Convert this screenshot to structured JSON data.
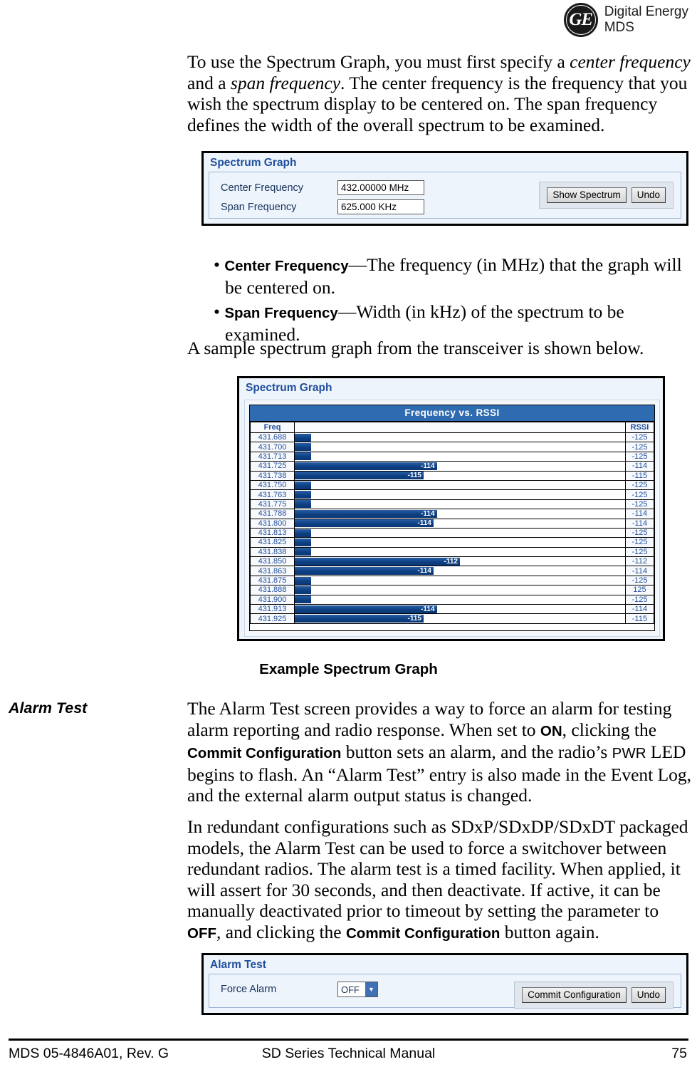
{
  "header": {
    "logo_mark": "GE",
    "logo_line1": "Digital Energy",
    "logo_line2": "MDS"
  },
  "intro_paragraph": {
    "part1": "To use the Spectrum Graph, you must first specify a ",
    "em1": "center frequency",
    "part2": " and a ",
    "em2": "span frequency",
    "part3": ". The center frequency is the frequency that you wish the spectrum display to be centered on. The span frequency defines the width of the overall spectrum to be examined."
  },
  "spectrum_panel": {
    "title": "Spectrum Graph",
    "fields": [
      {
        "label": "Center Frequency",
        "value": "432.00000 MHz"
      },
      {
        "label": "Span Frequency",
        "value": "625.000 KHz"
      }
    ],
    "buttons": [
      {
        "label": "Show Spectrum"
      },
      {
        "label": "Undo"
      }
    ]
  },
  "bullets": [
    {
      "term": "Center Frequency",
      "text": "—The frequency (in MHz) that the graph will be centered on."
    },
    {
      "term": "Span Frequency",
      "text": "—Width (in kHz) of the spectrum to be examined."
    }
  ],
  "sample_line": "A sample spectrum graph from the transceiver is shown below.",
  "graph_widget": {
    "panel_title": "Spectrum Graph",
    "chart_title": "Frequency vs. RSSI",
    "col_freq": "Freq",
    "col_rssi": "RSSI"
  },
  "chart_data": {
    "type": "bar",
    "title": "Frequency vs. RSSI",
    "xlabel": "RSSI",
    "ylabel": "Freq",
    "orientation": "horizontal",
    "grid": false,
    "legend": "none",
    "categories": [
      "431.688",
      "431.700",
      "431.713",
      "431.725",
      "431.738",
      "431.750",
      "431.763",
      "431.775",
      "431.788",
      "431.800",
      "431.813",
      "431.825",
      "431.838",
      "431.850",
      "431.863",
      "431.875",
      "431.888",
      "431.900",
      "431.913",
      "431.925"
    ],
    "values": [
      -125,
      -125,
      -125,
      -114,
      -115,
      -125,
      -125,
      -125,
      -114,
      -114,
      -125,
      -125,
      -125,
      -112,
      -114,
      -125,
      125,
      -125,
      -114,
      -115
    ],
    "bar_labels": [
      "",
      "",
      "",
      "-114",
      "-115",
      "",
      "",
      "",
      "-114",
      "-114",
      "",
      "",
      "",
      "-112",
      "-114",
      "",
      "",
      "",
      "-114",
      "-115"
    ],
    "bar_widths_pct": [
      5,
      5,
      5,
      43,
      39,
      5,
      5,
      5,
      43,
      42,
      5,
      5,
      5,
      50,
      42,
      5,
      5,
      5,
      43,
      39
    ],
    "rssi_labels": [
      "-125",
      "-125",
      "-125",
      "-114",
      "-115",
      "-125",
      "-125",
      "-125",
      "-114",
      "-114",
      "-125",
      "-125",
      "-125",
      "-112",
      "-114",
      "-125",
      "125",
      "-125",
      "-114",
      "-115"
    ]
  },
  "figure_caption": "Example Spectrum Graph",
  "alarm_section": {
    "heading": "Alarm Test",
    "para1_a": "The Alarm Test screen provides a way to force an alarm for testing alarm reporting and radio response. When set to ",
    "para1_on": "ON",
    "para1_b": ", clicking the ",
    "para1_commit": "Commit Configuration",
    "para1_c": " button sets an alarm, and the radio’s ",
    "para1_pwr": "PWR",
    "para1_d": " LED begins to flash. An “Alarm Test” entry is also made in the Event Log, and the external alarm output status is changed.",
    "para2_a": "In redundant configurations such as SDxP/SDxDP/SDxDT packaged models, the Alarm Test can be used to force a switchover between redundant radios. The alarm test is a timed facility. When applied, it will assert for 30 seconds, and then deactivate. If active, it can be manually deactivated prior to timeout by setting the parameter to ",
    "para2_off": "OFF",
    "para2_b": ", and clicking the ",
    "para2_commit": "Commit Configuration",
    "para2_c": " button again."
  },
  "alarm_panel": {
    "title": "Alarm Test",
    "field_label": "Force Alarm",
    "field_value": "OFF",
    "buttons": [
      {
        "label": "Commit Configuration"
      },
      {
        "label": "Undo"
      }
    ]
  },
  "footer": {
    "left": "MDS 05-4846A01, Rev. G",
    "center": "SD Series Technical Manual",
    "page": "75"
  }
}
